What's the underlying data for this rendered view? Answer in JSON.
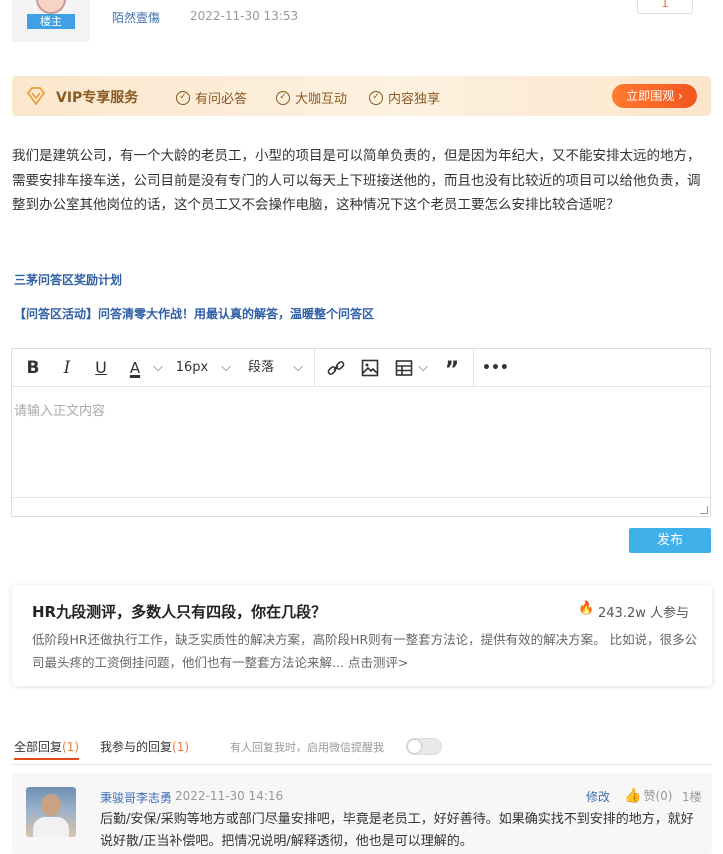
{
  "author": {
    "badge": "楼主",
    "name": "陌然壹傷",
    "time": "2022-11-30 13:53",
    "vote_count": "1"
  },
  "vip": {
    "title": "VIP专享服务",
    "features": [
      "有问必答",
      "大咖互动",
      "内容独享"
    ],
    "button": "立即围观 ›",
    "accent_color": "#f25622"
  },
  "question": {
    "text": "我们是建筑公司，有一个大龄的老员工，小型的项目是可以简单负责的，但是因为年纪大，又不能安排太远的地方，需要安排车接车送，公司目前是没有专门的人可以每天上下班接送他的，而且也没有比较近的项目可以给他负责，调整到办公室其他岗位的话，这个员工又不会操作电脑，这种情况下这个老员工要怎么安排比较合适呢？"
  },
  "activities": {
    "plan": "三茅问答区奖励计划",
    "event": "【问答区活动】问答清零大作战！用最认真的解答，温暖整个问答区"
  },
  "editor": {
    "font_size": "16px",
    "paragraph": "段落",
    "placeholder": "请输入正文内容",
    "icons": [
      "bold-icon",
      "italic-icon",
      "underline-icon",
      "font-color-icon",
      "link-icon",
      "image-icon",
      "table-icon",
      "quote-icon",
      "more-icon"
    ]
  },
  "publish_button": "发布",
  "hr_card": {
    "title": "HR九段测评，多数人只有四段，你在几段？",
    "count": "243.2w 人参与",
    "description": "低阶段HR还做执行工作，缺乏实质性的解决方案，高阶段HR则有一整套方法论，提供有效的解决方案。 比如说，很多公司最头疼的工资倒挂问题，他们也有一整套方法论来解... 点击测评>"
  },
  "reply_tabs": {
    "all_label": "全部回复",
    "all_count": "(1)",
    "mine_label": "我参与的回复",
    "mine_count": "(1)",
    "notice": "有人回复我时，启用微信提醒我"
  },
  "reply": {
    "name": "秉骏哥李志勇",
    "time": "2022-11-30 14:16",
    "edit": "修改",
    "like": "赞(0)",
    "floor": "1楼",
    "text": "后勤/安保/采购等地方或部门尽量安排吧，毕竟是老员工，好好善待。如果确实找不到安排的地方，就好说好散/正当补偿吧。把情况说明/解释透彻，他也是可以理解的。"
  }
}
